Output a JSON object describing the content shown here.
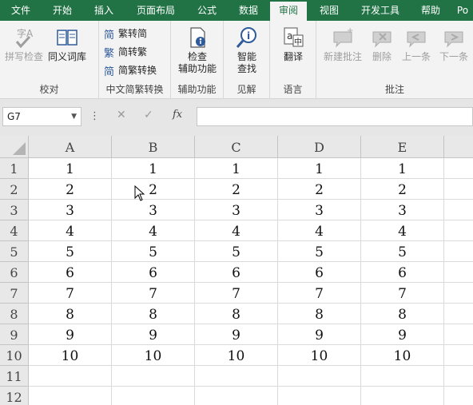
{
  "tabs": [
    {
      "label": "文件",
      "active": false
    },
    {
      "label": "开始",
      "active": false
    },
    {
      "label": "插入",
      "active": false
    },
    {
      "label": "页面布局",
      "active": false
    },
    {
      "label": "公式",
      "active": false
    },
    {
      "label": "数据",
      "active": false
    },
    {
      "label": "审阅",
      "active": true
    },
    {
      "label": "视图",
      "active": false
    },
    {
      "label": "开发工具",
      "active": false
    },
    {
      "label": "帮助",
      "active": false
    },
    {
      "label": "Po",
      "active": false
    }
  ],
  "ribbon": {
    "proofing": {
      "label": "校对",
      "spell_check": "拼写检查",
      "thesaurus": "同义词库"
    },
    "chinese_conversion": {
      "label": "中文简繁转换",
      "to_simplified": "繁转简",
      "to_traditional": "简转繁",
      "convert": "简繁转换"
    },
    "accessibility": {
      "label": "辅助功能",
      "check": "检查\n辅助功能"
    },
    "insights": {
      "label": "见解",
      "smart_lookup": "智能\n查找"
    },
    "language": {
      "label": "语言",
      "translate": "翻译"
    },
    "comments": {
      "label": "批注",
      "new_comment": "新建批注",
      "delete": "删除",
      "previous": "上一条",
      "next": "下一条"
    }
  },
  "formula_bar": {
    "name_box": "G7",
    "formula": "",
    "fx": "fx"
  },
  "columns": [
    "A",
    "B",
    "C",
    "D",
    "E"
  ],
  "rows": [
    {
      "num": "1",
      "cells": [
        "1",
        "1",
        "1",
        "1",
        "1"
      ]
    },
    {
      "num": "2",
      "cells": [
        "2",
        "2",
        "2",
        "2",
        "2"
      ]
    },
    {
      "num": "3",
      "cells": [
        "3",
        "3",
        "3",
        "3",
        "3"
      ]
    },
    {
      "num": "4",
      "cells": [
        "4",
        "4",
        "4",
        "4",
        "4"
      ]
    },
    {
      "num": "5",
      "cells": [
        "5",
        "5",
        "5",
        "5",
        "5"
      ]
    },
    {
      "num": "6",
      "cells": [
        "6",
        "6",
        "6",
        "6",
        "6"
      ]
    },
    {
      "num": "7",
      "cells": [
        "7",
        "7",
        "7",
        "7",
        "7"
      ]
    },
    {
      "num": "8",
      "cells": [
        "8",
        "8",
        "8",
        "8",
        "8"
      ]
    },
    {
      "num": "9",
      "cells": [
        "9",
        "9",
        "9",
        "9",
        "9"
      ]
    },
    {
      "num": "10",
      "cells": [
        "10",
        "10",
        "10",
        "10",
        "10"
      ]
    },
    {
      "num": "11",
      "cells": [
        "",
        "",
        "",
        "",
        ""
      ]
    },
    {
      "num": "12",
      "cells": [
        "",
        "",
        "",
        "",
        ""
      ]
    }
  ],
  "colors": {
    "accent": "#217346",
    "ribbon_bg": "#f3f3f3",
    "header_bg": "#e8e8e8"
  }
}
